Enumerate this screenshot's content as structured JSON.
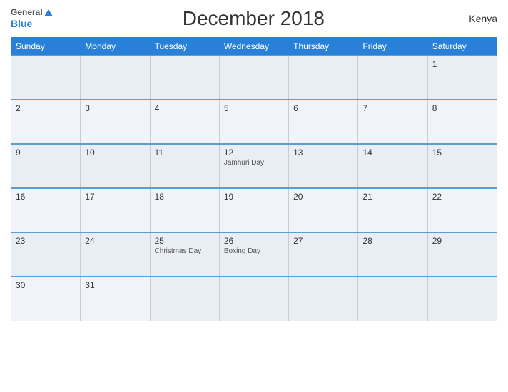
{
  "header": {
    "logo_general": "General",
    "logo_blue": "Blue",
    "title": "December 2018",
    "country": "Kenya"
  },
  "days": [
    "Sunday",
    "Monday",
    "Tuesday",
    "Wednesday",
    "Thursday",
    "Friday",
    "Saturday"
  ],
  "weeks": [
    [
      {
        "date": "",
        "event": ""
      },
      {
        "date": "",
        "event": ""
      },
      {
        "date": "",
        "event": ""
      },
      {
        "date": "",
        "event": ""
      },
      {
        "date": "",
        "event": ""
      },
      {
        "date": "",
        "event": ""
      },
      {
        "date": "1",
        "event": ""
      }
    ],
    [
      {
        "date": "2",
        "event": ""
      },
      {
        "date": "3",
        "event": ""
      },
      {
        "date": "4",
        "event": ""
      },
      {
        "date": "5",
        "event": ""
      },
      {
        "date": "6",
        "event": ""
      },
      {
        "date": "7",
        "event": ""
      },
      {
        "date": "8",
        "event": ""
      }
    ],
    [
      {
        "date": "9",
        "event": ""
      },
      {
        "date": "10",
        "event": ""
      },
      {
        "date": "11",
        "event": ""
      },
      {
        "date": "12",
        "event": "Jamhuri Day"
      },
      {
        "date": "13",
        "event": ""
      },
      {
        "date": "14",
        "event": ""
      },
      {
        "date": "15",
        "event": ""
      }
    ],
    [
      {
        "date": "16",
        "event": ""
      },
      {
        "date": "17",
        "event": ""
      },
      {
        "date": "18",
        "event": ""
      },
      {
        "date": "19",
        "event": ""
      },
      {
        "date": "20",
        "event": ""
      },
      {
        "date": "21",
        "event": ""
      },
      {
        "date": "22",
        "event": ""
      }
    ],
    [
      {
        "date": "23",
        "event": ""
      },
      {
        "date": "24",
        "event": ""
      },
      {
        "date": "25",
        "event": "Christmas Day"
      },
      {
        "date": "26",
        "event": "Boxing Day"
      },
      {
        "date": "27",
        "event": ""
      },
      {
        "date": "28",
        "event": ""
      },
      {
        "date": "29",
        "event": ""
      }
    ],
    [
      {
        "date": "30",
        "event": ""
      },
      {
        "date": "31",
        "event": ""
      },
      {
        "date": "",
        "event": ""
      },
      {
        "date": "",
        "event": ""
      },
      {
        "date": "",
        "event": ""
      },
      {
        "date": "",
        "event": ""
      },
      {
        "date": "",
        "event": ""
      }
    ]
  ]
}
